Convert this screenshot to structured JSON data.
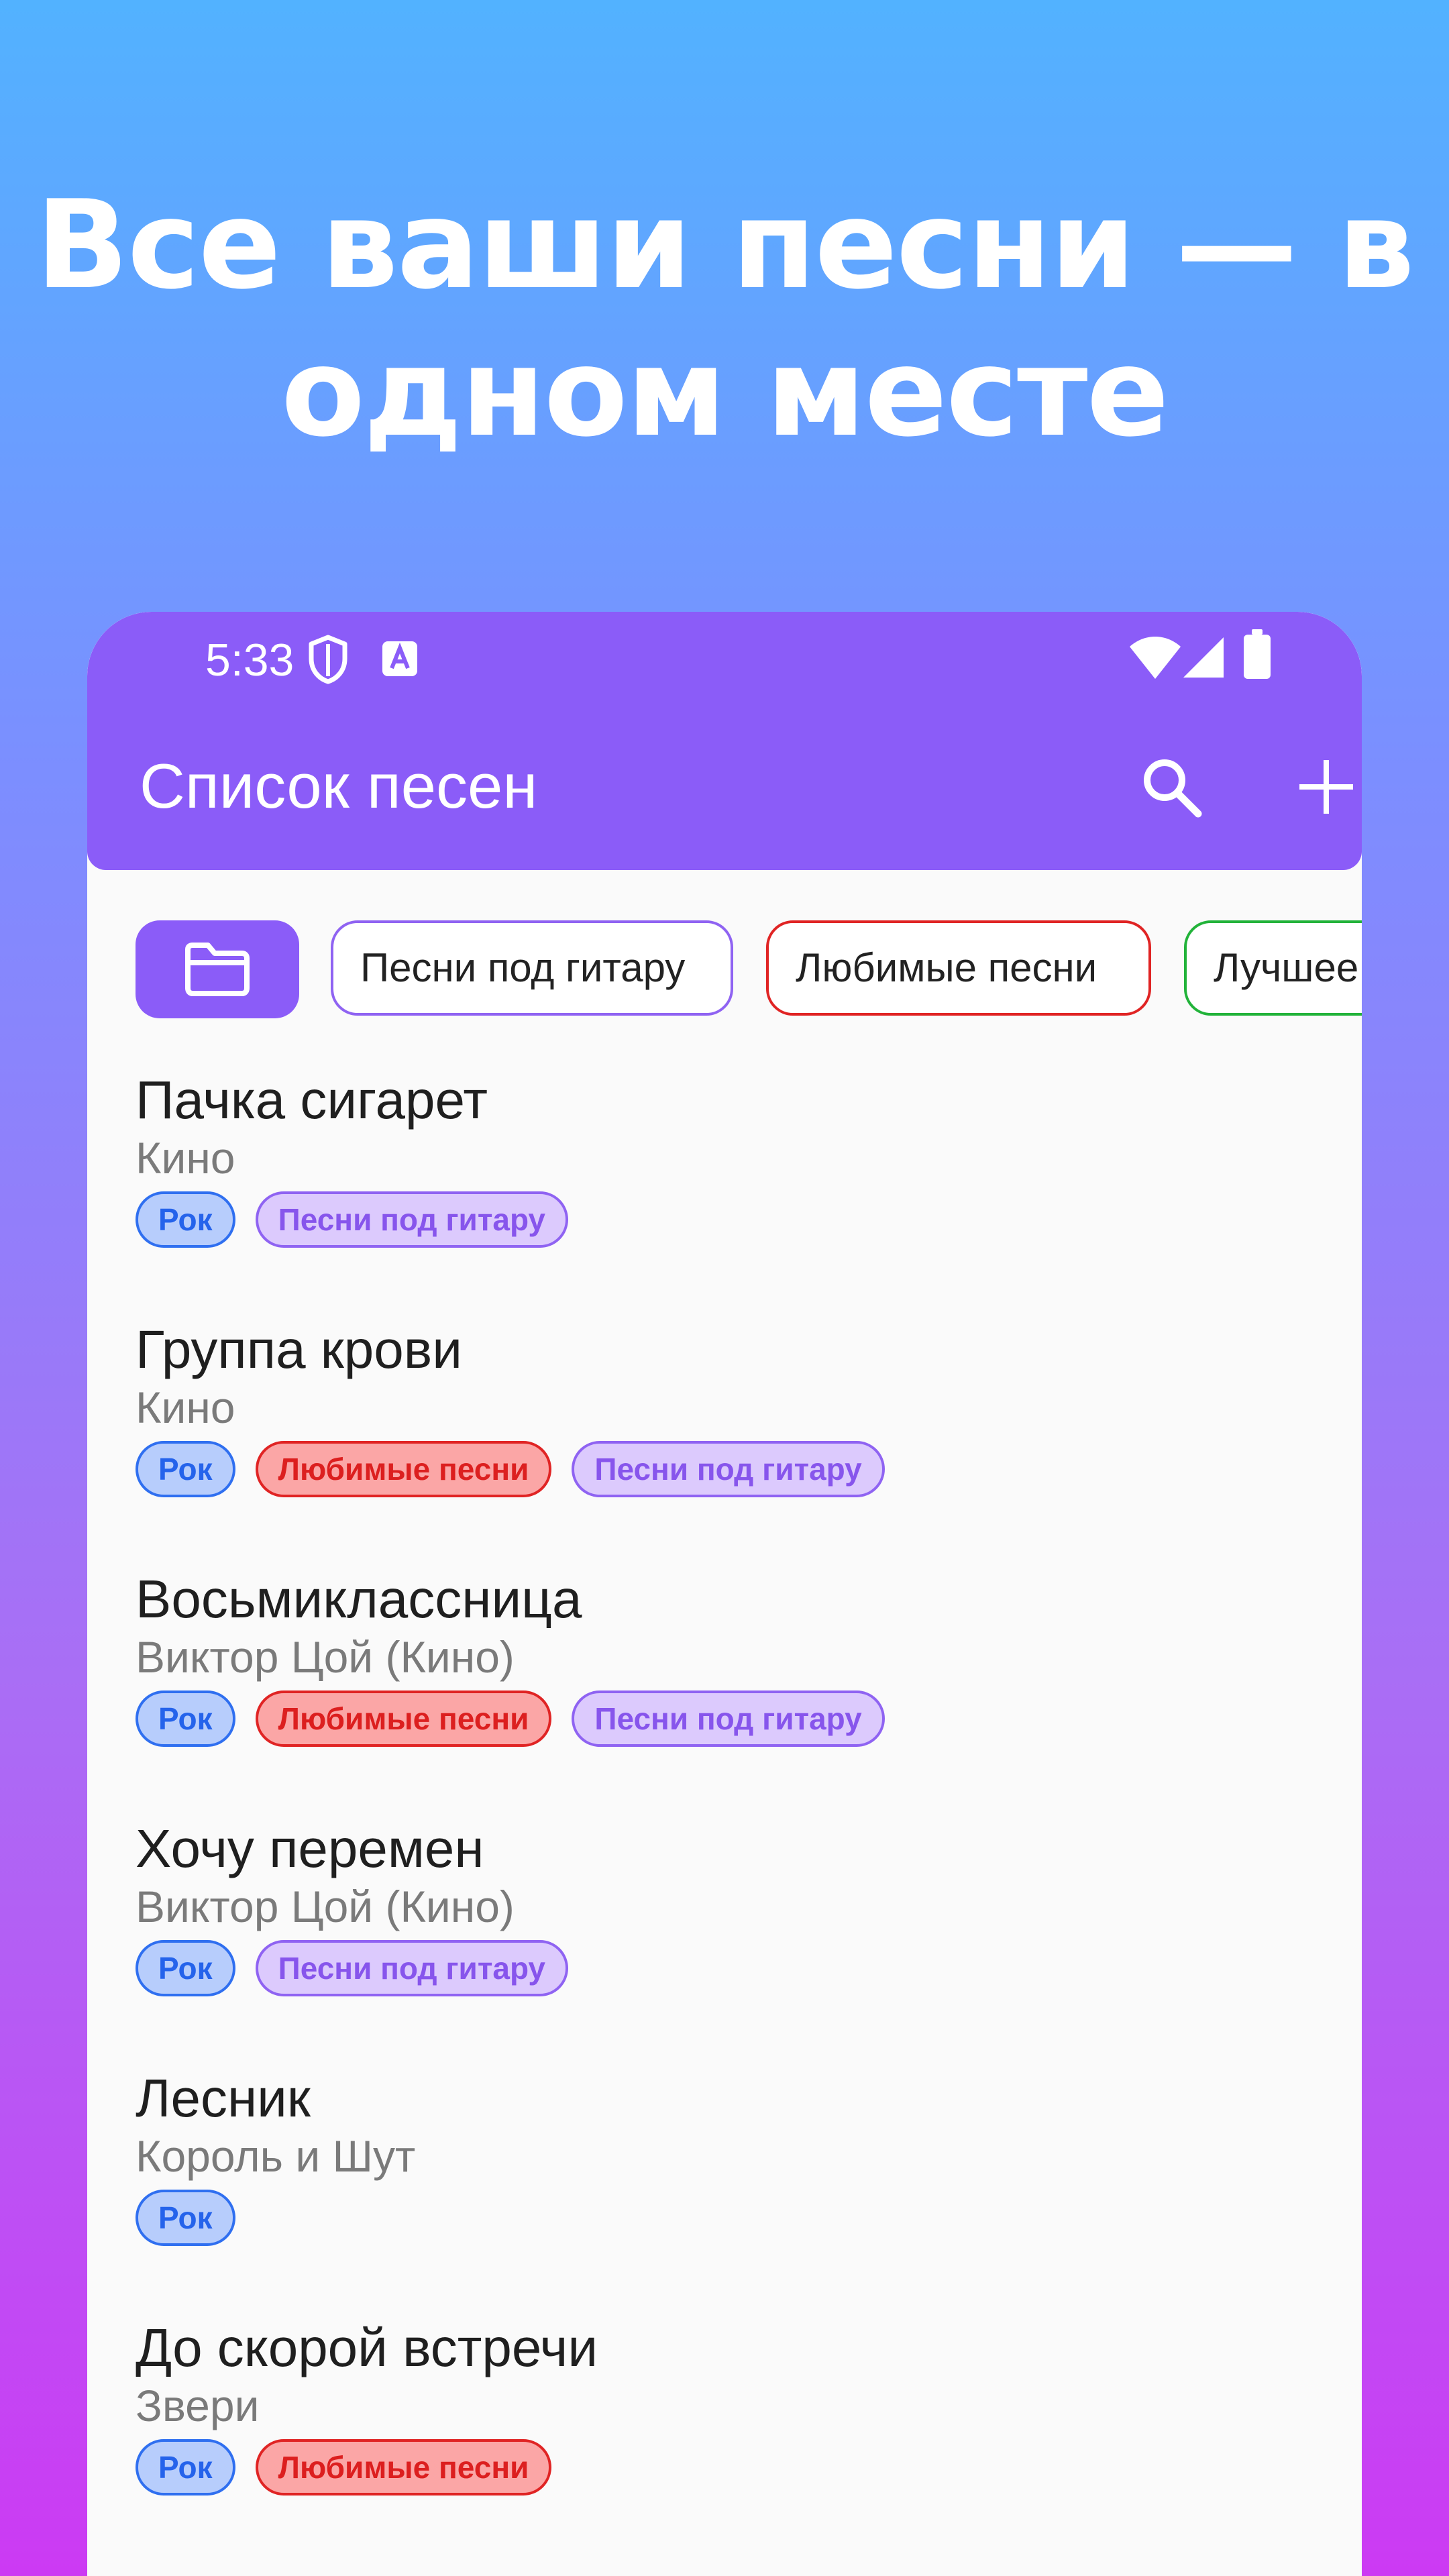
{
  "headline": {
    "line1": "Все ваши песни — в",
    "line2": "одном месте"
  },
  "status_bar": {
    "time": "5:33",
    "left_icons": [
      "shield-icon",
      "font-a-icon"
    ],
    "right_icons": [
      "wifi-icon",
      "signal-icon",
      "battery-icon"
    ]
  },
  "app_bar": {
    "title": "Список песен",
    "actions": [
      "search-icon",
      "plus-icon"
    ],
    "color": "#8b5cf8"
  },
  "filters": {
    "folder_icon": "folder-icon",
    "chips": [
      {
        "label": "Песни под гитару",
        "color": "#8f63f2"
      },
      {
        "label": "Любимые песни",
        "color": "#e02424"
      },
      {
        "label": "Лучшее",
        "color": "#22b33a"
      }
    ]
  },
  "songs": [
    {
      "title": "Пачка сигарет",
      "artist": "Кино",
      "tags": [
        "Рок",
        "Песни под гитару"
      ]
    },
    {
      "title": "Группа крови",
      "artist": "Кино",
      "tags": [
        "Рок",
        "Любимые песни",
        "Песни под гитару"
      ]
    },
    {
      "title": "Восьмиклассница",
      "artist": "Виктор Цой (Кино)",
      "tags": [
        "Рок",
        "Любимые песни",
        "Песни под гитару"
      ]
    },
    {
      "title": "Хочу перемен",
      "artist": "Виктор Цой (Кино)",
      "tags": [
        "Рок",
        "Песни под гитару"
      ]
    },
    {
      "title": "Лесник",
      "artist": "Король и Шут",
      "tags": [
        "Рок"
      ]
    },
    {
      "title": "До скорой встречи",
      "artist": "Звери",
      "tags": [
        "Рок",
        "Любимые песни"
      ]
    }
  ],
  "tag_colors": {
    "Рок": "#2f6ff0",
    "Любимые песни": "#e02424",
    "Песни под гитару": "#8f63f2"
  }
}
